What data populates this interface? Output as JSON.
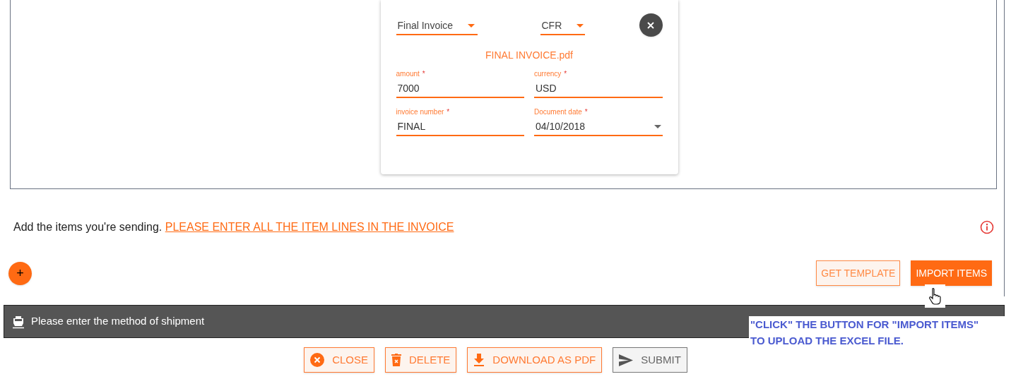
{
  "document_card": {
    "document_type": "Final Invoice",
    "incoterm": "CFR",
    "file_name": "FINAL INVOICE.pdf",
    "fields": [
      {
        "label": "amount",
        "required_mark": "*",
        "value": "7000",
        "kind": "text"
      },
      {
        "label": "currency",
        "required_mark": "*",
        "value": "USD",
        "kind": "text"
      },
      {
        "label": "invoice number",
        "required_mark": "*",
        "value": "FINAL",
        "kind": "text"
      },
      {
        "label": "Document date",
        "required_mark": "*",
        "value": "04/10/2018",
        "kind": "select"
      }
    ]
  },
  "items_section": {
    "text": "Add the items you're sending.",
    "link": "PLEASE ENTER ALL THE ITEM LINES IN THE INVOICE",
    "add_button": "+",
    "buttons": [
      {
        "label": "GET TEMPLATE",
        "kind": "outline"
      },
      {
        "label": "IMPORT ITEMS",
        "kind": "filled"
      }
    ]
  },
  "shipment_bar": {
    "title": "Please enter the method of shipment"
  },
  "annotation": "\"CLICK\" THE BUTTON FOR \"IMPORT ITEMS\" TO UPLOAD THE EXCEL FILE.",
  "actions": [
    {
      "label": "CLOSE",
      "disabled": false
    },
    {
      "label": "DELETE",
      "disabled": false
    },
    {
      "label": "DOWNLOAD AS PDF",
      "disabled": false
    },
    {
      "label": "SUBMIT",
      "disabled": true
    }
  ]
}
